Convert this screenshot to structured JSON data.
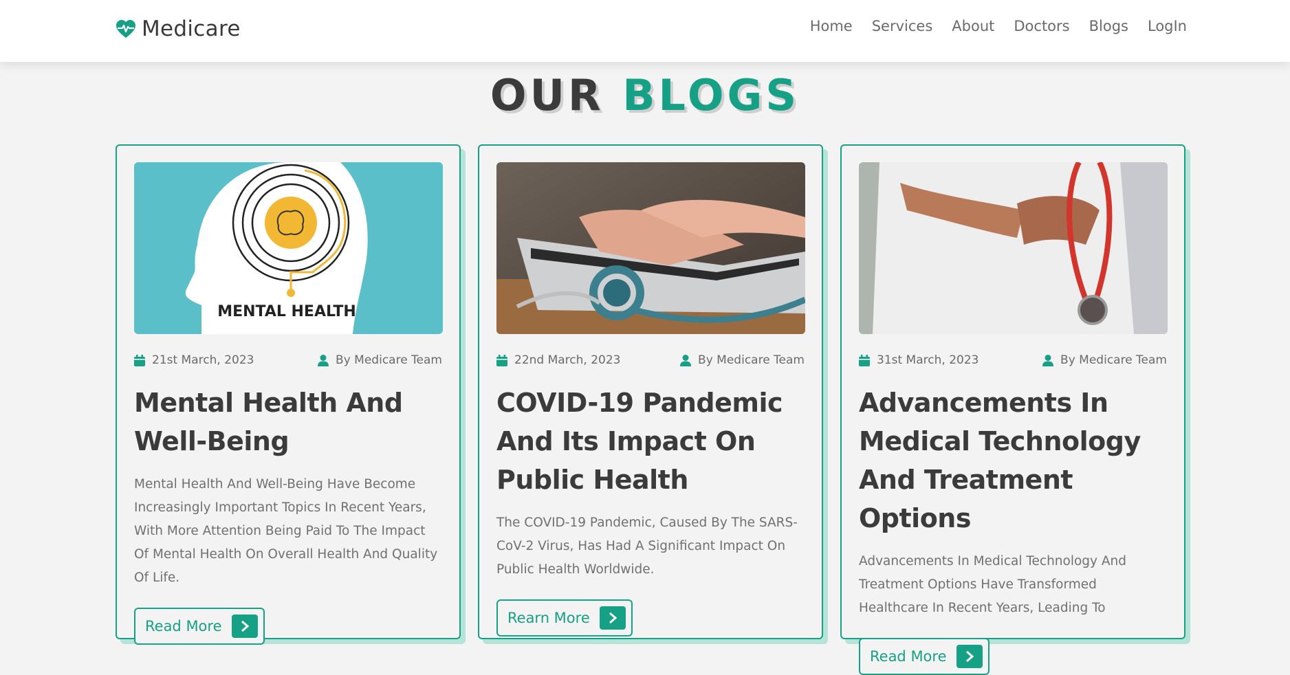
{
  "brand": {
    "name": "Medicare",
    "accent": "#16a085",
    "logo_icon": "heart-pulse-icon"
  },
  "nav": {
    "items": [
      "Home",
      "Services",
      "About",
      "Doctors",
      "Blogs",
      "LogIn"
    ]
  },
  "section": {
    "title_part1": "OUR",
    "title_part2": "BLOGS"
  },
  "blogs": [
    {
      "image": "mental-health-head-illustration",
      "image_text": "MENTAL HEALTH",
      "date": "21st March, 2023",
      "author": "By Medicare Team",
      "title": "Mental Health And Well-Being",
      "excerpt": "Mental Health And Well-Being Have Become Increasingly Important Topics In Recent Years, With More Attention Being Paid To The Impact Of Mental Health On Overall Health And Quality Of Life.",
      "button": "Read More"
    },
    {
      "image": "laptop-stethoscope-photo",
      "date": "22nd March, 2023",
      "author": "By Medicare Team",
      "title": "COVID-19 Pandemic And Its Impact On Public Health",
      "excerpt": "The COVID-19 Pandemic, Caused By The SARS-CoV-2 Virus, Has Had A Significant Impact On Public Health Worldwide.",
      "button": "Rearn More"
    },
    {
      "image": "doctor-with-stethoscope-photo",
      "date": "31st March, 2023",
      "author": "By Medicare Team",
      "title": "Advancements In Medical Technology And Treatment Options",
      "excerpt": "Advancements In Medical Technology And Treatment Options Have Transformed Healthcare In Recent Years, Leading To",
      "button": "Read More"
    }
  ]
}
